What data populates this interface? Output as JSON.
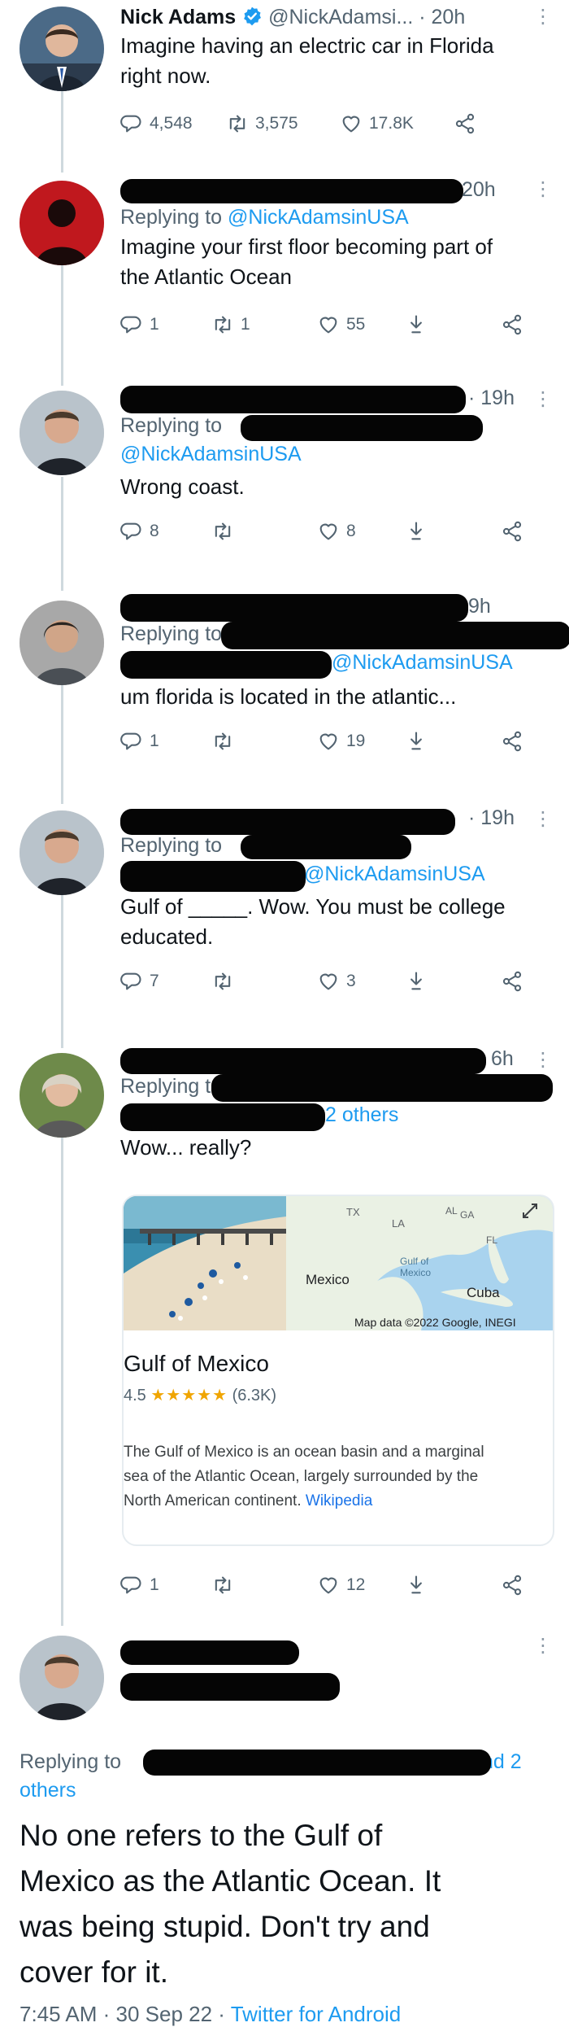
{
  "thread": [
    {
      "name": "Nick Adams",
      "verified": true,
      "handle": "@NickAdamsi...",
      "time": "· 20h",
      "text_lines": [
        "Imagine having an electric car in Florida",
        "right now."
      ],
      "counts": {
        "reply": "4,548",
        "retweet": "3,575",
        "like": "17.8K"
      }
    },
    {
      "time": "20h",
      "reply_prefix": "Replying to ",
      "reply_mention": "@NickAdamsinUSA",
      "text_lines": [
        "Imagine your first floor becoming part of",
        "the Atlantic Ocean"
      ],
      "counts": {
        "reply": "1",
        "retweet": "1",
        "like": "55"
      }
    },
    {
      "time": "· 19h",
      "reply_prefix": "Replying to",
      "reply_mention": "@NickAdamsinUSA",
      "text_lines": [
        "Wrong coast."
      ],
      "counts": {
        "reply": "8",
        "like": "8"
      }
    },
    {
      "time": "9h",
      "reply_prefix": "Replying to",
      "reply_mention": "@NickAdamsinUSA",
      "text_lines": [
        "um florida is located in the atlantic..."
      ],
      "counts": {
        "reply": "1",
        "like": "19"
      }
    },
    {
      "time": "· 19h",
      "reply_prefix": "Replying to",
      "reply_mention": "@NickAdamsinUSA",
      "text_lines": [
        "Gulf of _____. Wow. You must be college",
        "educated."
      ],
      "counts": {
        "reply": "7",
        "like": "3"
      }
    },
    {
      "time": "6h",
      "reply_prefix": "Replying t",
      "reply_others": "2 others",
      "text_lines": [
        "Wow... really?"
      ],
      "counts": {
        "reply": "1",
        "like": "12"
      }
    }
  ],
  "card": {
    "map_labels": {
      "tx": "TX",
      "la": "LA",
      "al": "AL",
      "ga": "GA",
      "fl": "FL",
      "mexico": "Mexico",
      "gulf1": "Gulf of",
      "gulf2": "Mexico",
      "cuba": "Cuba"
    },
    "attribution": "Map data ©2022 Google, INEGI",
    "title": "Gulf of Mexico",
    "rating": "4.5",
    "stars": "★★★★★",
    "reviews": "(6.3K)",
    "desc_lines": [
      "The Gulf of Mexico is an ocean basin and a marginal",
      "sea of the Atlantic Ocean, largely surrounded by the",
      "North American continent. "
    ],
    "desc_link": "Wikipedia"
  },
  "main": {
    "reply_prefix": "Replying to",
    "reply_and": "and 2",
    "reply_others": "others",
    "text_lines": [
      "No one refers to the Gulf of",
      "Mexico as the Atlantic Ocean. It",
      "was being stupid. Don't try and",
      "cover for it."
    ],
    "timestamp": "7:45 AM · 30 Sep 22 · ",
    "client": "Twitter for Android"
  },
  "colors": {
    "link": "#1d9bf0",
    "muted": "#536471",
    "redaction": "#050505"
  }
}
